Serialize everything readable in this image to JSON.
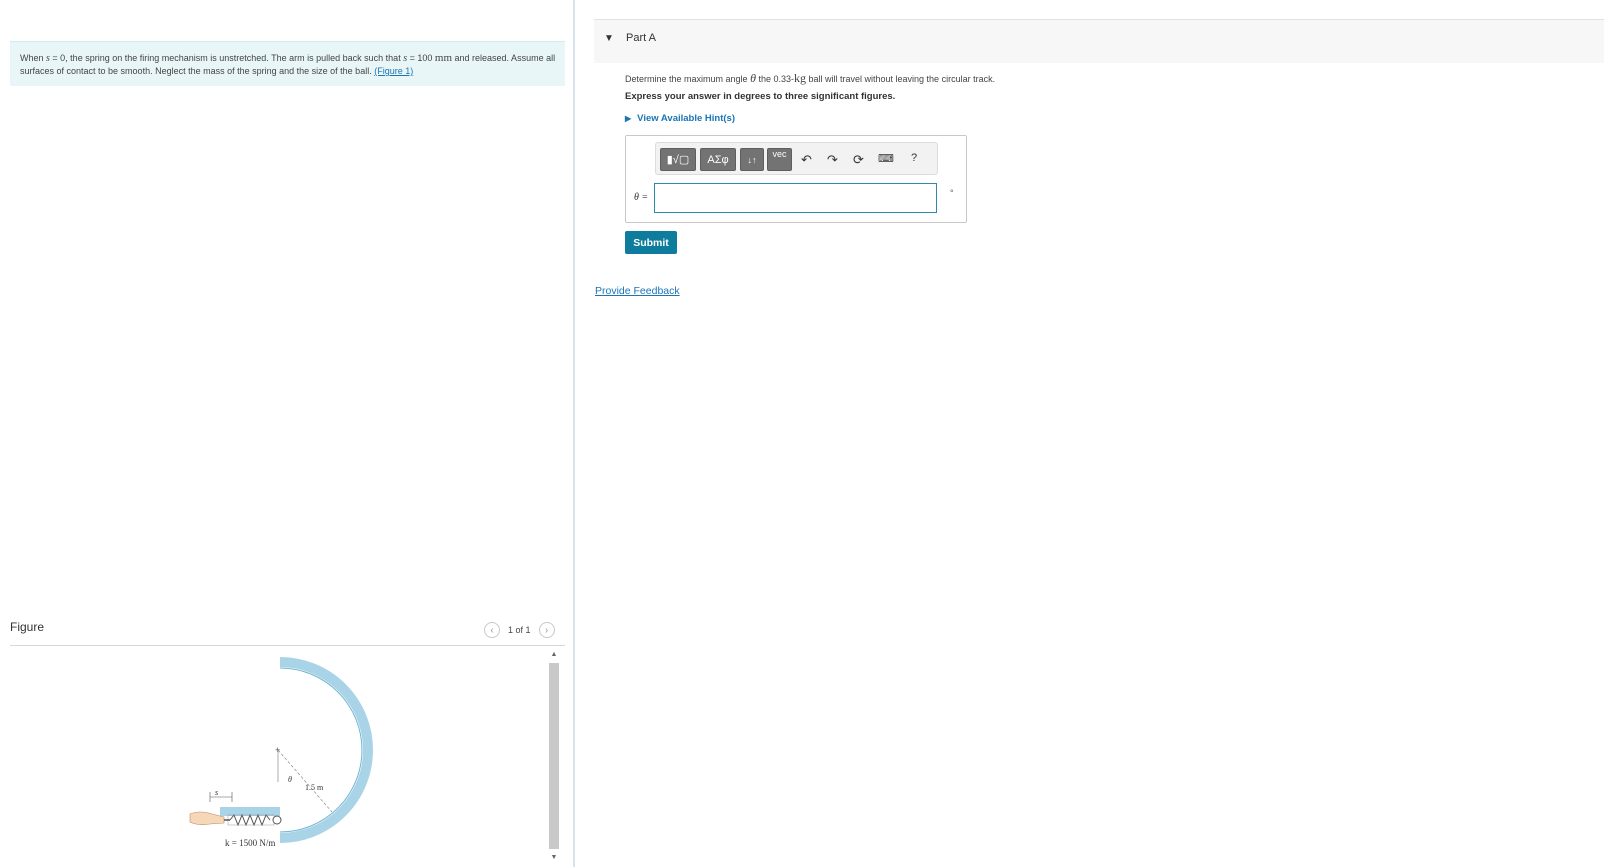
{
  "problem": {
    "text_1": "When ",
    "var_s": "s",
    "text_2": " = 0, the spring on the firing mechanism is unstretched. The arm is pulled back such that ",
    "var_s2": "s",
    "text_3": " = 100 ",
    "unit_mm": "mm",
    "text_4": " and released. Assume all surfaces of contact to be smooth. Neglect the mass of the spring and the size of the ball. ",
    "figure_link": "(Figure 1)"
  },
  "figure": {
    "label": "Figure",
    "pager_text": "1 of 1",
    "prev_icon": "chevron-left-icon",
    "next_icon": "chevron-right-icon",
    "labels": {
      "radius": "1.5 m",
      "spring": "k = 1500 N/m",
      "theta": "θ",
      "s": "s"
    }
  },
  "part": {
    "title": "Part A",
    "question_1": "Determine the maximum angle ",
    "question_theta": "θ",
    "question_2": " the 0.33-",
    "question_unit": "kg",
    "question_3": " ball will travel without leaving the circular track.",
    "instruction": "Express your answer in degrees to three significant figures.",
    "hint": "View Available Hint(s)"
  },
  "answer": {
    "variable_label": "θ =",
    "value": "",
    "unit": "°",
    "toolbar": {
      "templates_label": "▮√▢",
      "symbols_label": "ΑΣφ",
      "arrows_label": "↓↑",
      "vec_label": "vec",
      "undo_icon": "↶",
      "redo_icon": "↷",
      "reset_icon": "⟳",
      "keyboard_icon": "⌨",
      "help_label": "?"
    },
    "submit_label": "Submit"
  },
  "feedback_label": "Provide Feedback",
  "colors": {
    "accent": "#0e7c9c",
    "link": "#1a75b5",
    "problem_bg": "#e9f6f8",
    "track": "#a9d3e6"
  }
}
